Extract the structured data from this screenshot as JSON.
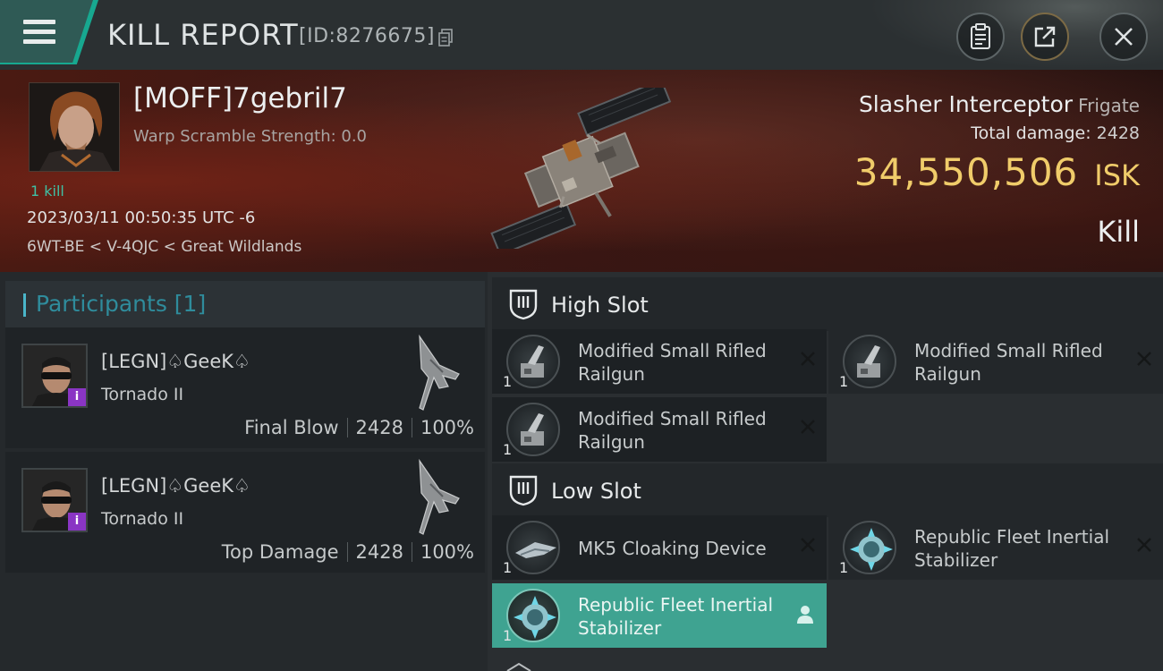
{
  "header": {
    "title": "KILL REPORT",
    "id_label": "[ID:8276675]"
  },
  "victim": {
    "name": "[MOFF]7gebril7",
    "scramble_label": "Warp Scramble Strength: 0.0",
    "kills_label": "1 kill",
    "datetime": "2023/03/11 00:50:35 UTC -6",
    "location": "6WT-BE < V-4QJC < Great Wildlands",
    "ship_name": "Slasher Interceptor",
    "ship_class": "Frigate",
    "total_damage_label": "Total damage:",
    "total_damage_value": "2428",
    "isk_value": "34,550,506",
    "isk_unit": "ISK",
    "result": "Kill"
  },
  "participants": {
    "title": "Participants [1]",
    "rows": [
      {
        "name": "[LEGN]♤GeeK♤",
        "ship": "Tornado II",
        "role": "Final Blow",
        "damage": "2428",
        "percent": "100%",
        "badge": "i"
      },
      {
        "name": "[LEGN]♤GeeK♤",
        "ship": "Tornado II",
        "role": "Top Damage",
        "damage": "2428",
        "percent": "100%",
        "badge": "i"
      }
    ]
  },
  "fittings": {
    "high_slot": {
      "title": "High Slot",
      "items": [
        {
          "qty": "1",
          "name": "Modified Small Rifled Railgun",
          "icon": "railgun-icon"
        },
        {
          "qty": "1",
          "name": "Modified Small Rifled Railgun",
          "icon": "railgun-icon"
        },
        {
          "qty": "1",
          "name": "Modified Small Rifled Railgun",
          "icon": "railgun-icon"
        }
      ]
    },
    "low_slot": {
      "title": "Low Slot",
      "items": [
        {
          "qty": "1",
          "name": "MK5 Cloaking Device",
          "icon": "cloaking-device-icon"
        },
        {
          "qty": "1",
          "name": "Republic Fleet Inertial Stabilizer",
          "icon": "inertial-stabilizer-icon"
        },
        {
          "qty": "1",
          "name": "Republic Fleet Inertial Stabilizer",
          "icon": "inertial-stabilizer-icon",
          "highlighted": true
        }
      ]
    }
  },
  "colors": {
    "accent_teal": "#17a890",
    "isk_gold": "#f0cc6a",
    "participants_title": "#2f8c9c",
    "highlight_item": "#3fa391",
    "badge_purple": "#8a35c4"
  }
}
